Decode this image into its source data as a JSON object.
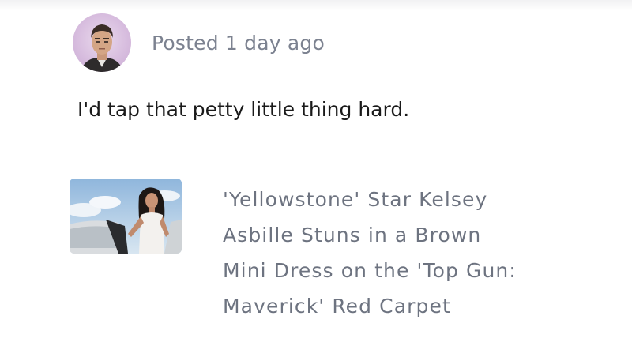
{
  "comment": {
    "avatar": {
      "icon": "user-avatar-portrait",
      "background": "#d8bedf"
    },
    "meta": "Posted 1 day ago",
    "text": "I'd tap that petty little thing hard."
  },
  "related_article": {
    "thumbnail": {
      "icon": "article-photo"
    },
    "headline_lines": [
      "'Yellowstone' Star Kelsey",
      "Asbille Stuns in a Brown",
      "Mini Dress on the 'Top Gun:",
      "Maverick' Red Carpet"
    ]
  },
  "colors": {
    "meta_text": "#7c8290",
    "body_text": "#1a1a1a",
    "headline_text": "#6d7380"
  }
}
